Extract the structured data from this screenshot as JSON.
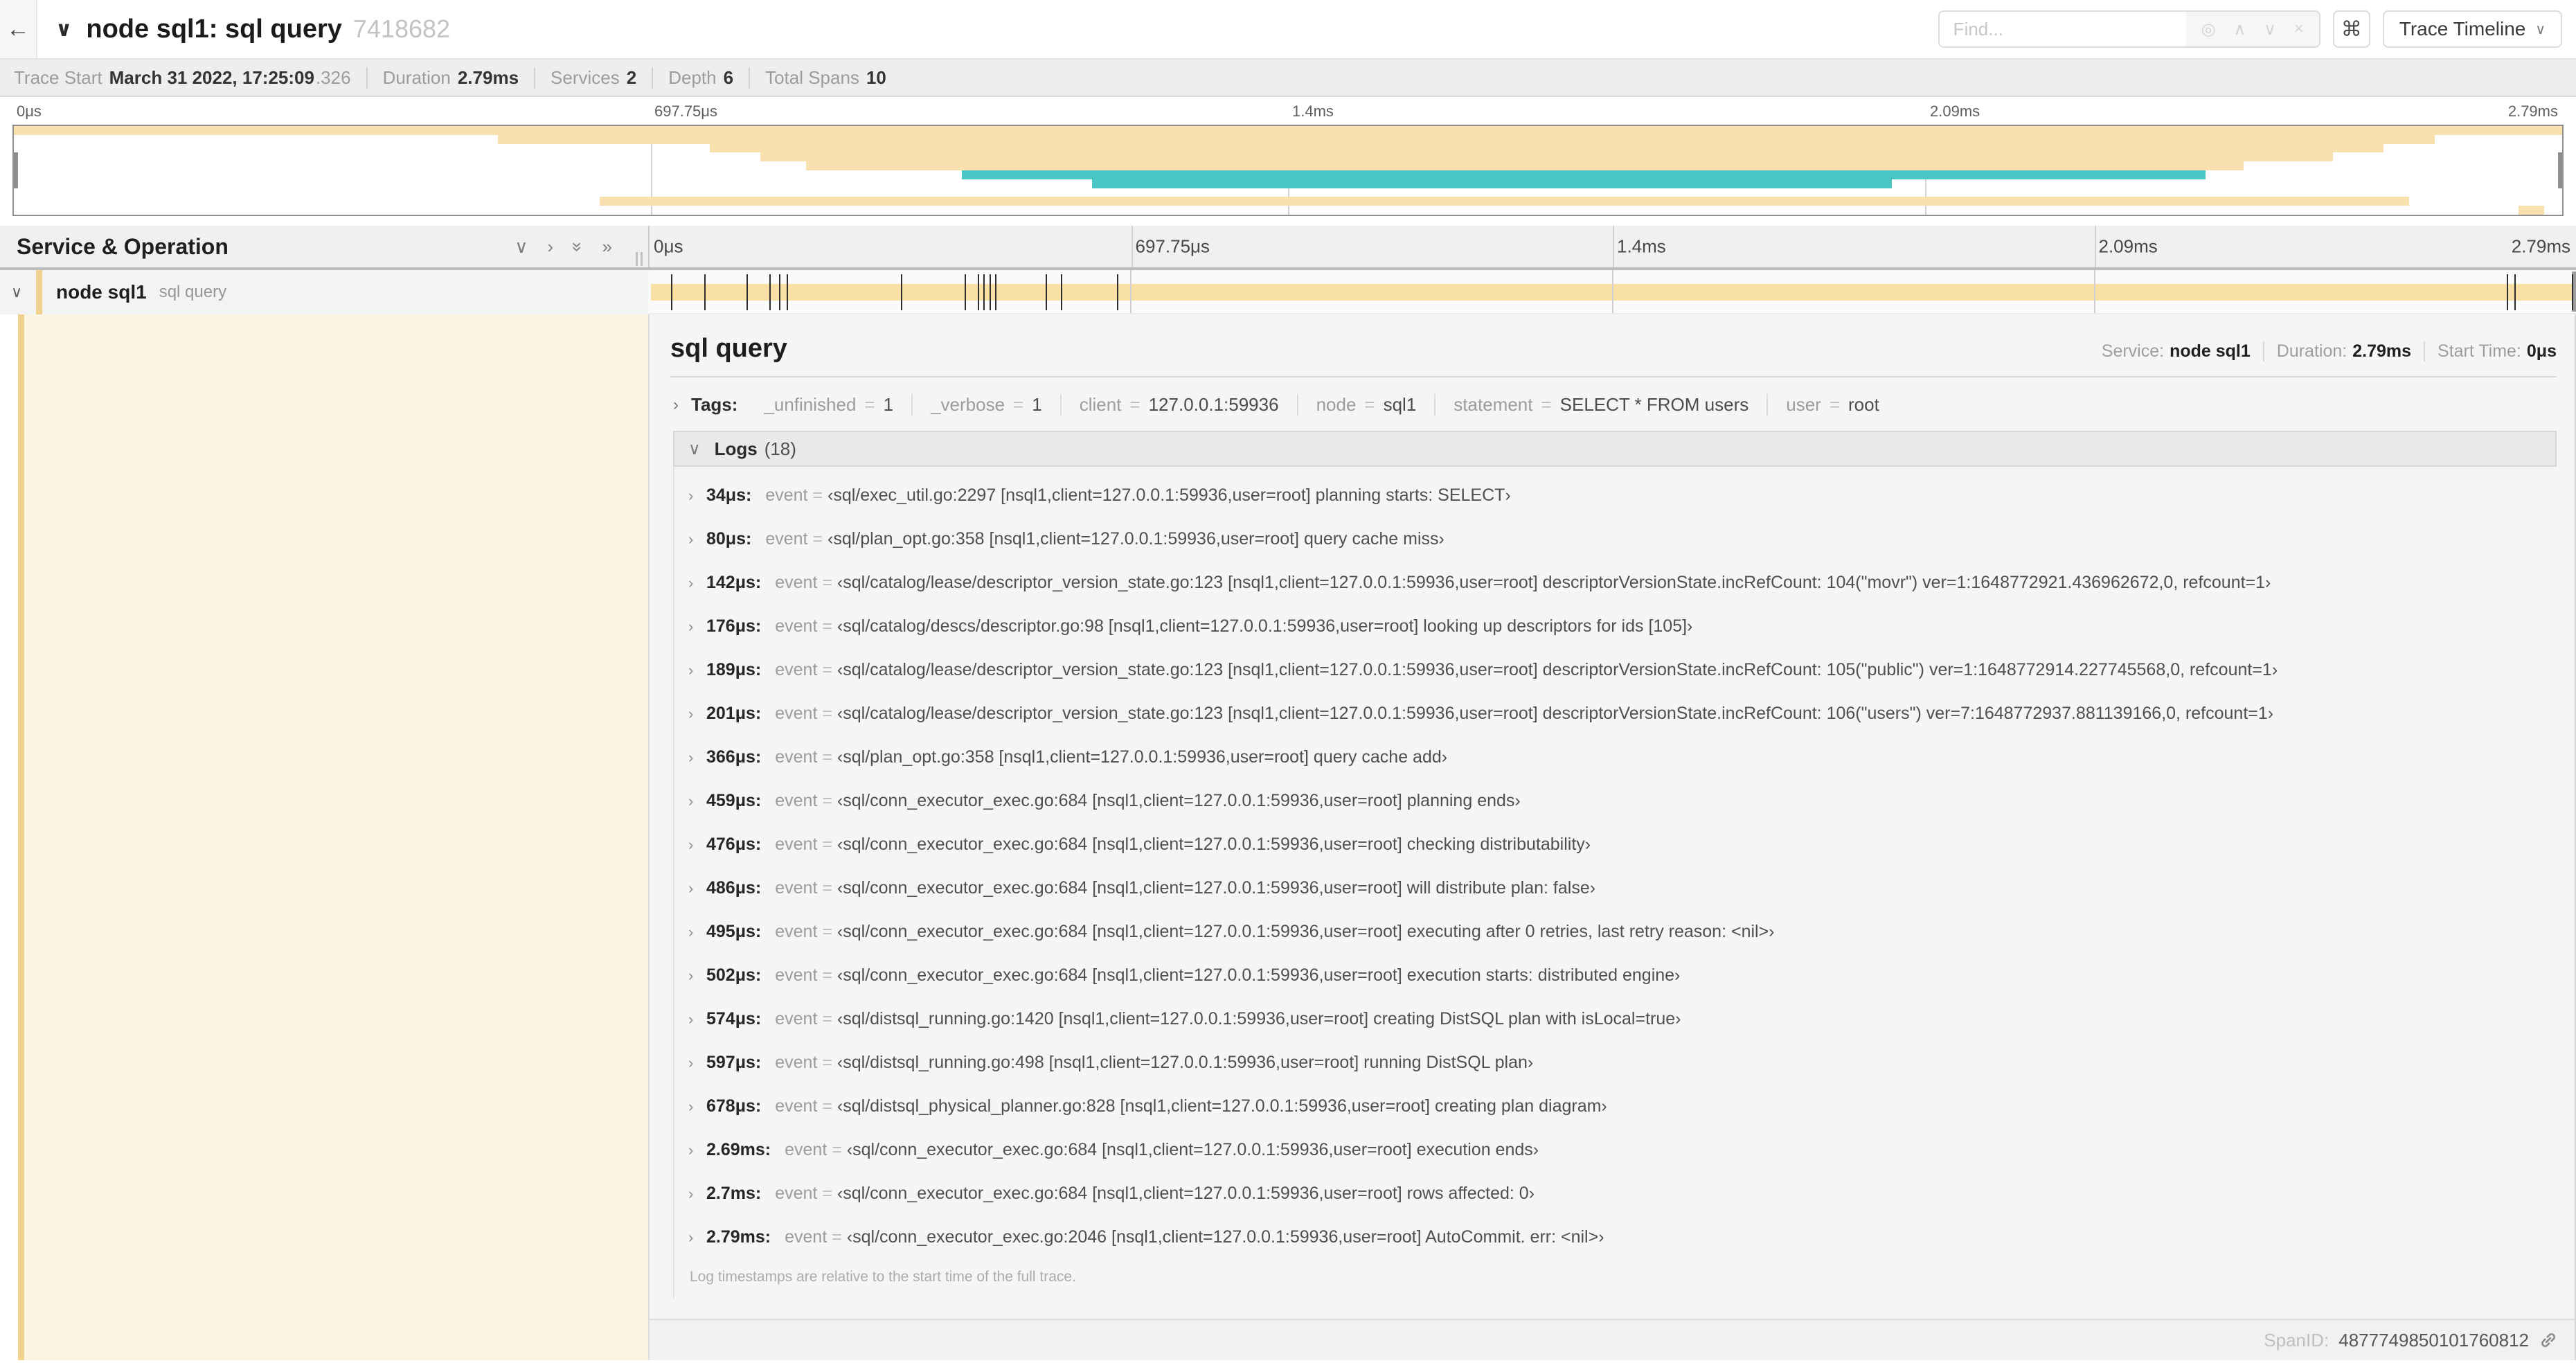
{
  "header": {
    "title": "node sql1: sql query",
    "trace_id_short": "7418682",
    "find_placeholder": "Find...",
    "view_selector": "Trace Timeline"
  },
  "icons": {
    "back": "←",
    "collapse_header": "∨",
    "chevron_down": "∨",
    "chevron_right": "›",
    "double_chevron_down": "»",
    "double_chevron_right": "»",
    "find_target": "◎",
    "prev_match": "∧",
    "next_match": "∨",
    "clear_search": "×",
    "keyboard_shortcut": "⌘",
    "dropdown_caret": "∨"
  },
  "summary": {
    "items": [
      {
        "label": "Trace Start",
        "value": "March 31 2022, 17:25:09",
        "suffix": ".326"
      },
      {
        "label": "Duration",
        "value": "2.79ms"
      },
      {
        "label": "Services",
        "value": "2"
      },
      {
        "label": "Depth",
        "value": "6"
      },
      {
        "label": "Total Spans",
        "value": "10"
      }
    ]
  },
  "minimap": {
    "ticks": [
      "0μs",
      "697.75μs",
      "1.4ms",
      "2.09ms",
      "2.79ms"
    ],
    "total_rows": 10,
    "rows": [
      {
        "row": 0,
        "start": 0,
        "end": 100,
        "color": "tan"
      },
      {
        "row": 1,
        "start": 19,
        "end": 95,
        "color": "tan"
      },
      {
        "row": 2,
        "start": 27.3,
        "end": 93,
        "color": "tan"
      },
      {
        "row": 3,
        "start": 29.3,
        "end": 91,
        "color": "tan"
      },
      {
        "row": 4,
        "start": 31.1,
        "end": 87.5,
        "color": "tan"
      },
      {
        "row": 5,
        "start": 37.2,
        "end": 86,
        "color": "teal"
      },
      {
        "row": 6,
        "start": 42.3,
        "end": 73.7,
        "color": "teal"
      },
      {
        "row": 8,
        "start": 23,
        "end": 94,
        "color": "tan"
      },
      {
        "row": 9,
        "start": 98.3,
        "end": 99.3,
        "color": "tan"
      }
    ]
  },
  "timeline": {
    "left_header": "Service & Operation",
    "ticks": [
      "0μs",
      "697.75μs",
      "1.4ms",
      "2.09ms",
      "2.79ms"
    ],
    "span_row": {
      "service": "node sql1",
      "operation": "sql query",
      "log_marks": [
        1.2,
        2.9,
        5.1,
        6.3,
        6.8,
        7.2,
        13.1,
        16.4,
        17.1,
        17.4,
        17.7,
        18.0,
        20.6,
        21.4,
        24.3,
        96.4,
        96.8,
        99.8
      ]
    }
  },
  "detail": {
    "title": "sql query",
    "meta": [
      {
        "label": "Service:",
        "value": "node sql1"
      },
      {
        "label": "Duration:",
        "value": "2.79ms"
      },
      {
        "label": "Start Time:",
        "value": "0μs"
      }
    ],
    "tags_label": "Tags:",
    "tags": [
      {
        "key": "_unfinished",
        "value": "1"
      },
      {
        "key": "_verbose",
        "value": "1"
      },
      {
        "key": "client",
        "value": "127.0.0.1:59936"
      },
      {
        "key": "node",
        "value": "sql1"
      },
      {
        "key": "statement",
        "value": "SELECT * FROM users"
      },
      {
        "key": "user",
        "value": "root"
      }
    ],
    "logs_label": "Logs",
    "logs_count": "(18)",
    "logs": [
      {
        "time": "34μs:",
        "field": "event",
        "value": "‹sql/exec_util.go:2297 [nsql1,client=127.0.0.1:59936,user=root] planning starts: SELECT›"
      },
      {
        "time": "80μs:",
        "field": "event",
        "value": "‹sql/plan_opt.go:358 [nsql1,client=127.0.0.1:59936,user=root] query cache miss›"
      },
      {
        "time": "142μs:",
        "field": "event",
        "value": "‹sql/catalog/lease/descriptor_version_state.go:123 [nsql1,client=127.0.0.1:59936,user=root] descriptorVersionState.incRefCount: 104(\"movr\") ver=1:1648772921.436962672,0, refcount=1›"
      },
      {
        "time": "176μs:",
        "field": "event",
        "value": "‹sql/catalog/descs/descriptor.go:98 [nsql1,client=127.0.0.1:59936,user=root] looking up descriptors for ids [105]›"
      },
      {
        "time": "189μs:",
        "field": "event",
        "value": "‹sql/catalog/lease/descriptor_version_state.go:123 [nsql1,client=127.0.0.1:59936,user=root] descriptorVersionState.incRefCount: 105(\"public\") ver=1:1648772914.227745568,0, refcount=1›"
      },
      {
        "time": "201μs:",
        "field": "event",
        "value": "‹sql/catalog/lease/descriptor_version_state.go:123 [nsql1,client=127.0.0.1:59936,user=root] descriptorVersionState.incRefCount: 106(\"users\") ver=7:1648772937.881139166,0, refcount=1›"
      },
      {
        "time": "366μs:",
        "field": "event",
        "value": "‹sql/plan_opt.go:358 [nsql1,client=127.0.0.1:59936,user=root] query cache add›"
      },
      {
        "time": "459μs:",
        "field": "event",
        "value": "‹sql/conn_executor_exec.go:684 [nsql1,client=127.0.0.1:59936,user=root] planning ends›"
      },
      {
        "time": "476μs:",
        "field": "event",
        "value": "‹sql/conn_executor_exec.go:684 [nsql1,client=127.0.0.1:59936,user=root] checking distributability›"
      },
      {
        "time": "486μs:",
        "field": "event",
        "value": "‹sql/conn_executor_exec.go:684 [nsql1,client=127.0.0.1:59936,user=root] will distribute plan: false›"
      },
      {
        "time": "495μs:",
        "field": "event",
        "value": "‹sql/conn_executor_exec.go:684 [nsql1,client=127.0.0.1:59936,user=root] executing after 0 retries, last retry reason: <nil>›"
      },
      {
        "time": "502μs:",
        "field": "event",
        "value": "‹sql/conn_executor_exec.go:684 [nsql1,client=127.0.0.1:59936,user=root] execution starts: distributed engine›"
      },
      {
        "time": "574μs:",
        "field": "event",
        "value": "‹sql/distsql_running.go:1420 [nsql1,client=127.0.0.1:59936,user=root] creating DistSQL plan with isLocal=true›"
      },
      {
        "time": "597μs:",
        "field": "event",
        "value": "‹sql/distsql_running.go:498 [nsql1,client=127.0.0.1:59936,user=root] running DistSQL plan›"
      },
      {
        "time": "678μs:",
        "field": "event",
        "value": "‹sql/distsql_physical_planner.go:828 [nsql1,client=127.0.0.1:59936,user=root] creating plan diagram›"
      },
      {
        "time": "2.69ms:",
        "field": "event",
        "value": "‹sql/conn_executor_exec.go:684 [nsql1,client=127.0.0.1:59936,user=root] execution ends›"
      },
      {
        "time": "2.7ms:",
        "field": "event",
        "value": "‹sql/conn_executor_exec.go:684 [nsql1,client=127.0.0.1:59936,user=root] rows affected: 0›"
      },
      {
        "time": "2.79ms:",
        "field": "event",
        "value": "‹sql/conn_executor_exec.go:2046 [nsql1,client=127.0.0.1:59936,user=root] AutoCommit. err: <nil>›"
      }
    ],
    "logs_note": "Log timestamps are relative to the start time of the full trace.",
    "spanid_label": "SpanID:",
    "spanid": "4877749850101760812"
  },
  "colors": {
    "span_tan": "#F8E1AE",
    "span_teal": "#49C6C3",
    "bar_tan": "#F8DFA4",
    "accent_strip": "#F0D18D",
    "accent_fill": "#FBF4E1"
  }
}
